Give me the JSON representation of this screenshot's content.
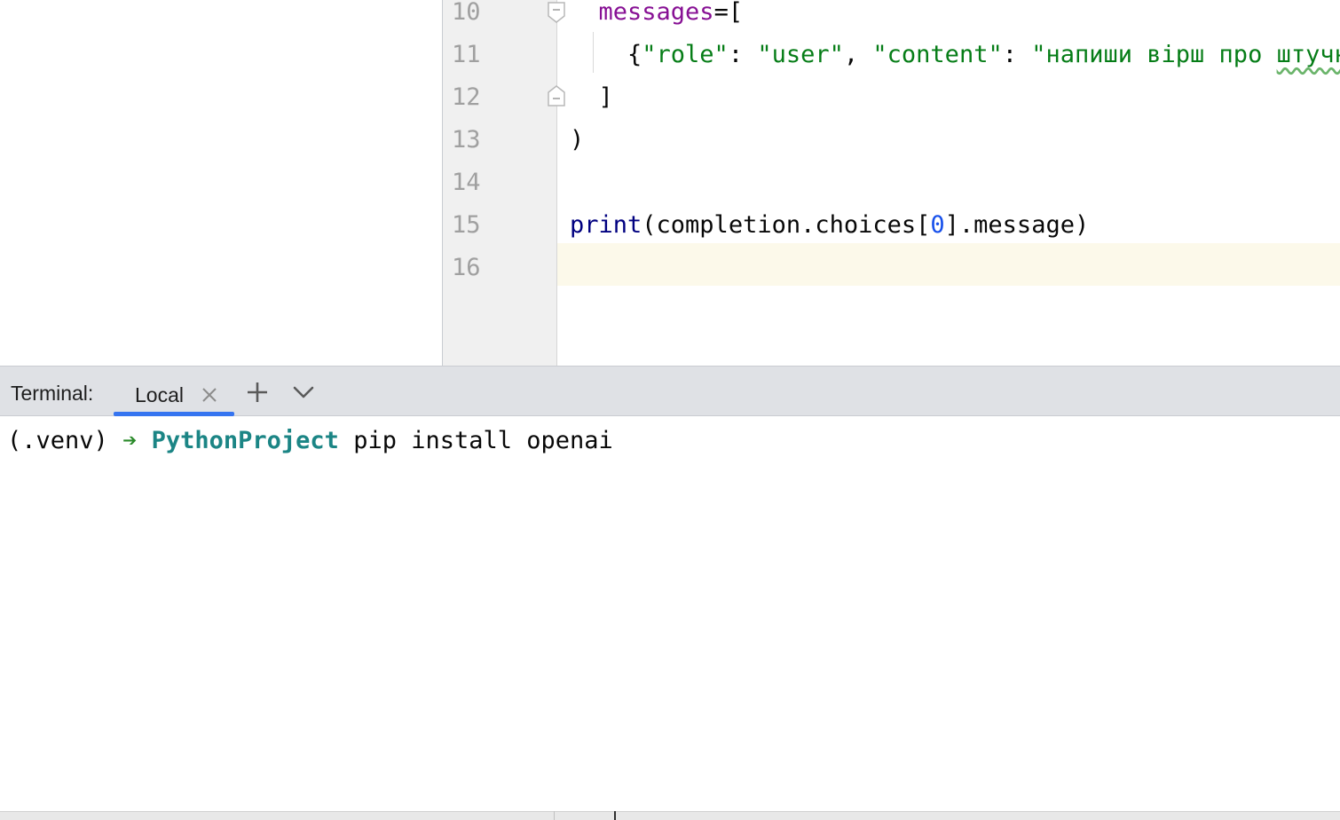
{
  "editor": {
    "line_numbers": [
      "10",
      "11",
      "12",
      "13",
      "14",
      "15",
      "16"
    ],
    "lines": [
      {
        "number": "10",
        "tokens": [
          {
            "text": "  ",
            "kind": "plain"
          },
          {
            "text": "messages",
            "kind": "kw"
          },
          {
            "text": "=[",
            "kind": "plain"
          }
        ]
      },
      {
        "number": "11",
        "tokens": [
          {
            "text": "    {",
            "kind": "plain"
          },
          {
            "text": "\"role\"",
            "kind": "str"
          },
          {
            "text": ": ",
            "kind": "plain"
          },
          {
            "text": "\"user\"",
            "kind": "str"
          },
          {
            "text": ", ",
            "kind": "plain"
          },
          {
            "text": "\"content\"",
            "kind": "str"
          },
          {
            "text": ": ",
            "kind": "plain"
          },
          {
            "text": "\"напиши вірш про ",
            "kind": "str"
          },
          {
            "text": "штучн",
            "kind": "str-warn"
          }
        ]
      },
      {
        "number": "12",
        "tokens": [
          {
            "text": "  ]",
            "kind": "plain"
          }
        ]
      },
      {
        "number": "13",
        "tokens": [
          {
            "text": ")",
            "kind": "plain"
          }
        ]
      },
      {
        "number": "14",
        "tokens": []
      },
      {
        "number": "15",
        "tokens": [
          {
            "text": "print",
            "kind": "fn"
          },
          {
            "text": "(completion.choices[",
            "kind": "plain"
          },
          {
            "text": "0",
            "kind": "num"
          },
          {
            "text": "].message)",
            "kind": "plain"
          }
        ]
      },
      {
        "number": "16",
        "tokens": []
      }
    ],
    "caret_line": "16",
    "colors": {
      "keyword_arg": "#871094",
      "builtin": "#000080",
      "string": "#067d17",
      "number": "#1750eb",
      "caret_line_bg": "#fcf9ea",
      "gutter_bg": "#f0f0f0"
    }
  },
  "terminal": {
    "title": "Terminal:",
    "tabs": [
      {
        "label": "Local",
        "active": true,
        "close_icon": "close-icon"
      }
    ],
    "new_tab_icon": "plus-icon",
    "more_tabs_icon": "chevron-down-icon",
    "prompt": {
      "venv": "(.venv)",
      "arrow": "➔",
      "project": "PythonProject",
      "command": "pip install openai"
    },
    "colors": {
      "arrow": "#2a8a2a",
      "project": "#1b8585",
      "tab_underline": "#3574f0",
      "header_bg": "#dfe1e5"
    }
  }
}
